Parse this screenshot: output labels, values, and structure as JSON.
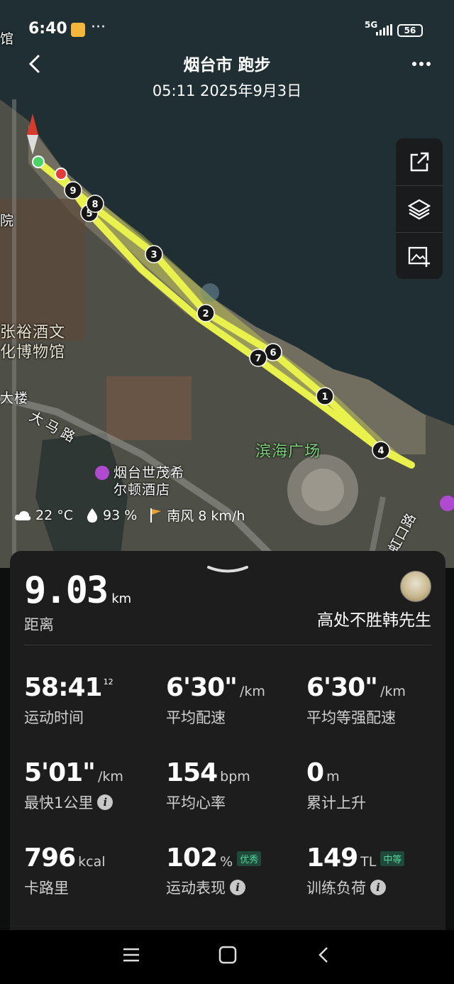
{
  "status_bar": {
    "time": "6:40",
    "dots": "···",
    "network": "5G",
    "battery": "56"
  },
  "header": {
    "title": "烟台市 跑步",
    "subtitle": "05:11 2025年9月3日"
  },
  "map_labels": {
    "hotel_museum": "张裕酒文\n化博物馆",
    "tower": "大楼",
    "road_dama": "大马路",
    "square": "滨海广场",
    "hilton_line1": "烟台世茂希",
    "hilton_line2": "尔顿酒店",
    "road_hong": "虹口路",
    "edge_yuan": "院",
    "edge_guan": "馆"
  },
  "km_markers": [
    "1",
    "2",
    "3",
    "4",
    "5",
    "6",
    "7",
    "8",
    "9"
  ],
  "weather": {
    "temp": "22 °C",
    "humidity": "93 %",
    "wind": "南风 8 km/h"
  },
  "summary": {
    "distance_value": "9.03",
    "distance_unit": "km",
    "distance_label": "距离",
    "username": "高处不胜韩先生"
  },
  "stats": {
    "duration": {
      "value": "58:41",
      "sup": "12",
      "label": "运动时间"
    },
    "avg_pace": {
      "value": "6'30\"",
      "unit": "/km",
      "label": "平均配速"
    },
    "avg_grade_pace": {
      "value": "6'30\"",
      "unit": "/km",
      "label": "平均等强配速"
    },
    "fastest_km": {
      "value": "5'01\"",
      "unit": "/km",
      "label": "最快1公里"
    },
    "avg_hr": {
      "value": "154",
      "unit": "bpm",
      "label": "平均心率"
    },
    "ascent": {
      "value": "0",
      "unit": "m",
      "label": "累计上升"
    },
    "calories": {
      "value": "796",
      "unit": "kcal",
      "label": "卡路里"
    },
    "performance": {
      "value": "102",
      "unit": "%",
      "badge": "优秀",
      "label": "运动表现"
    },
    "training_load": {
      "value": "149",
      "unit": "TL",
      "badge": "中等",
      "label": "训练负荷"
    }
  },
  "icons": {
    "back": "chevron-left-icon",
    "more": "more-icon",
    "share": "share-icon",
    "layers": "layers-icon",
    "add_image": "add-image-icon",
    "info": "info-icon"
  }
}
